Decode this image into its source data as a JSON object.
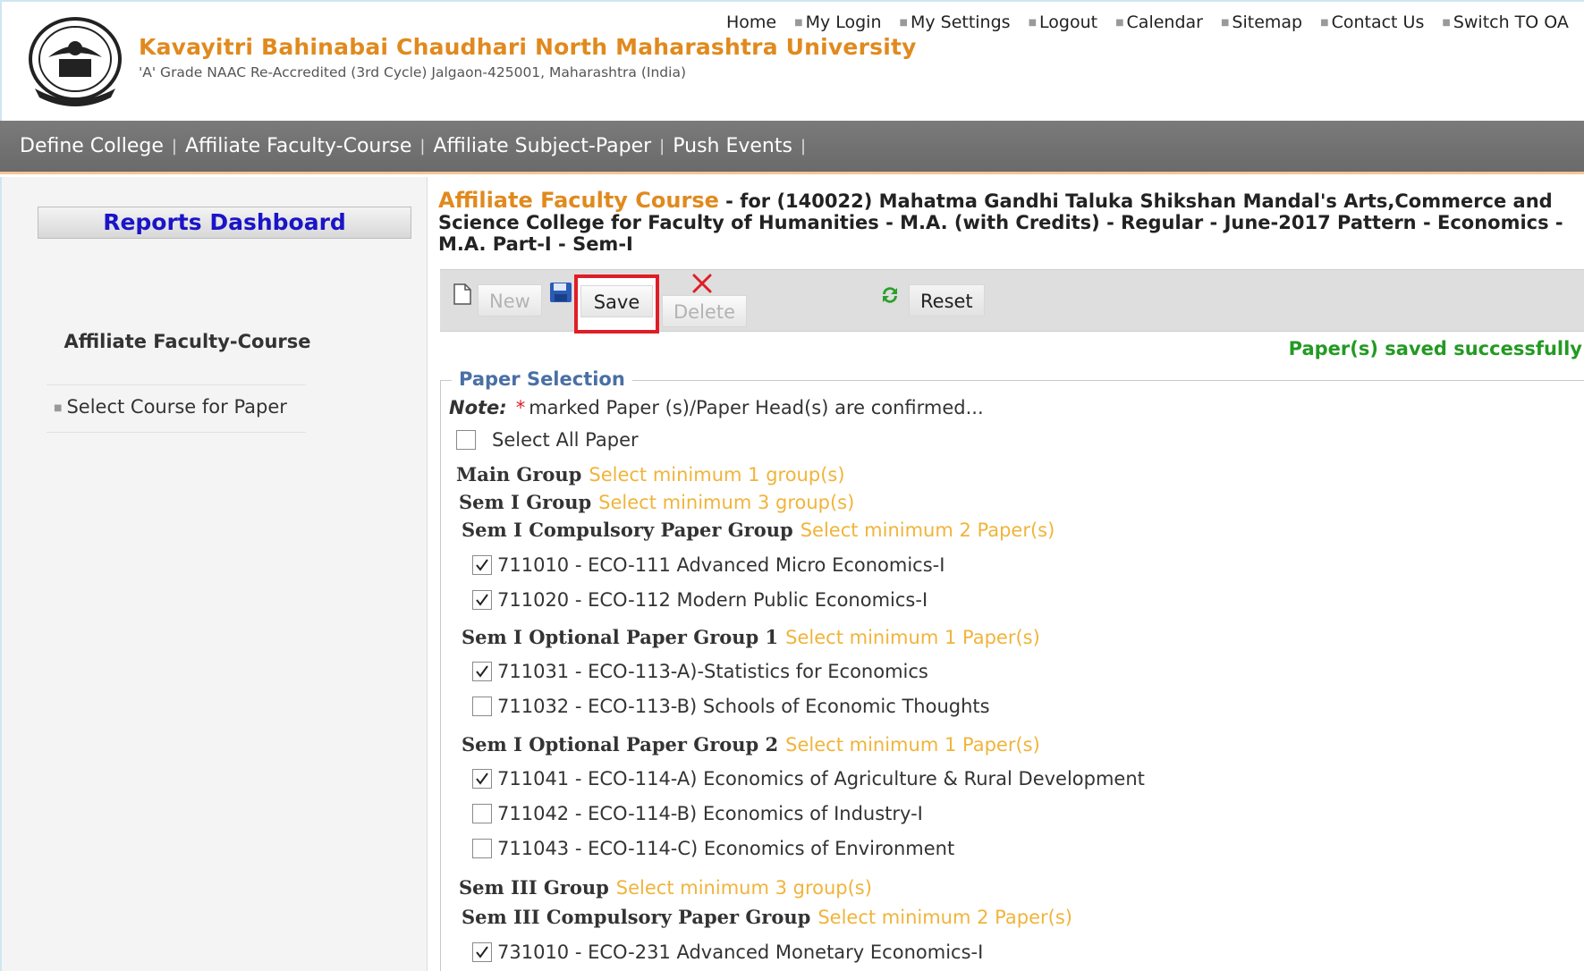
{
  "header": {
    "university_name": "Kavayitri Bahinabai Chaudhari North Maharashtra University",
    "subtitle": "'A' Grade NAAC Re-Accredited (3rd Cycle) Jalgaon-425001, Maharashtra (India)",
    "top_links": [
      "Home",
      "My Login",
      "My Settings",
      "Logout",
      "Calendar",
      "Sitemap",
      "Contact Us",
      "Switch TO OA"
    ]
  },
  "navbar": {
    "items": [
      "Define College",
      "Affiliate Faculty-Course",
      "Affiliate Subject-Paper",
      "Push Events"
    ]
  },
  "sidebar": {
    "dashboard_label": "Reports Dashboard",
    "section_title": "Affiliate Faculty-Course",
    "link": "Select Course for Paper"
  },
  "main": {
    "title_accent": "Affiliate Faculty Course",
    "title_rest": " - for (140022) Mahatma Gandhi Taluka Shikshan Mandal's Arts,Commerce and Science College for Faculty of Humanities - M.A. (with Credits) - Regular - June-2017 Pattern - Economics - M.A. Part-I - Sem-I",
    "toolbar": {
      "new_label": "New",
      "save_label": "Save",
      "delete_label": "Delete",
      "reset_label": "Reset"
    },
    "status_message": "Paper(s) saved successfully",
    "fieldset_legend": "Paper Selection",
    "note_label": "Note:",
    "note_star": "*",
    "note_text": "marked Paper (s)/Paper Head(s) are confirmed...",
    "select_all_label": "Select All Paper",
    "groups": [
      {
        "title": "Main Group",
        "hint": "Select minimum 1 group(s)"
      },
      {
        "title": "Sem I Group",
        "hint": "Select minimum 3 group(s)"
      },
      {
        "title": "Sem I Compulsory Paper Group",
        "hint": "Select minimum 2 Paper(s)"
      },
      {
        "title": "Sem I Optional Paper Group 1",
        "hint": "Select minimum 1 Paper(s)"
      },
      {
        "title": "Sem I Optional Paper Group 2",
        "hint": "Select minimum 1 Paper(s)"
      },
      {
        "title": "Sem III Group",
        "hint": "Select minimum 3 group(s)"
      },
      {
        "title": "Sem III Compulsory Paper Group",
        "hint": "Select minimum 2 Paper(s)"
      }
    ],
    "papers": [
      {
        "label": "711010 - ECO-111 Advanced Micro Economics-I",
        "checked": true
      },
      {
        "label": "711020 - ECO-112 Modern Public Economics-I",
        "checked": true
      },
      {
        "label": "711031 - ECO-113-A)-Statistics for Economics",
        "checked": true
      },
      {
        "label": "711032 - ECO-113-B) Schools of Economic Thoughts",
        "checked": false
      },
      {
        "label": "711041 - ECO-114-A) Economics of Agriculture & Rural Development",
        "checked": true
      },
      {
        "label": "711042 - ECO-114-B) Economics of Industry-I",
        "checked": false
      },
      {
        "label": "711043 - ECO-114-C) Economics of Environment",
        "checked": false
      },
      {
        "label": "731010 - ECO-231 Advanced Monetary Economics-I",
        "checked": true
      }
    ]
  },
  "colors": {
    "accent_orange": "#e08a1e",
    "hint_yellow": "#f0b43b",
    "success_green": "#239a23",
    "highlight_red": "#e01d26",
    "dashboard_blue": "#1a14c8"
  }
}
